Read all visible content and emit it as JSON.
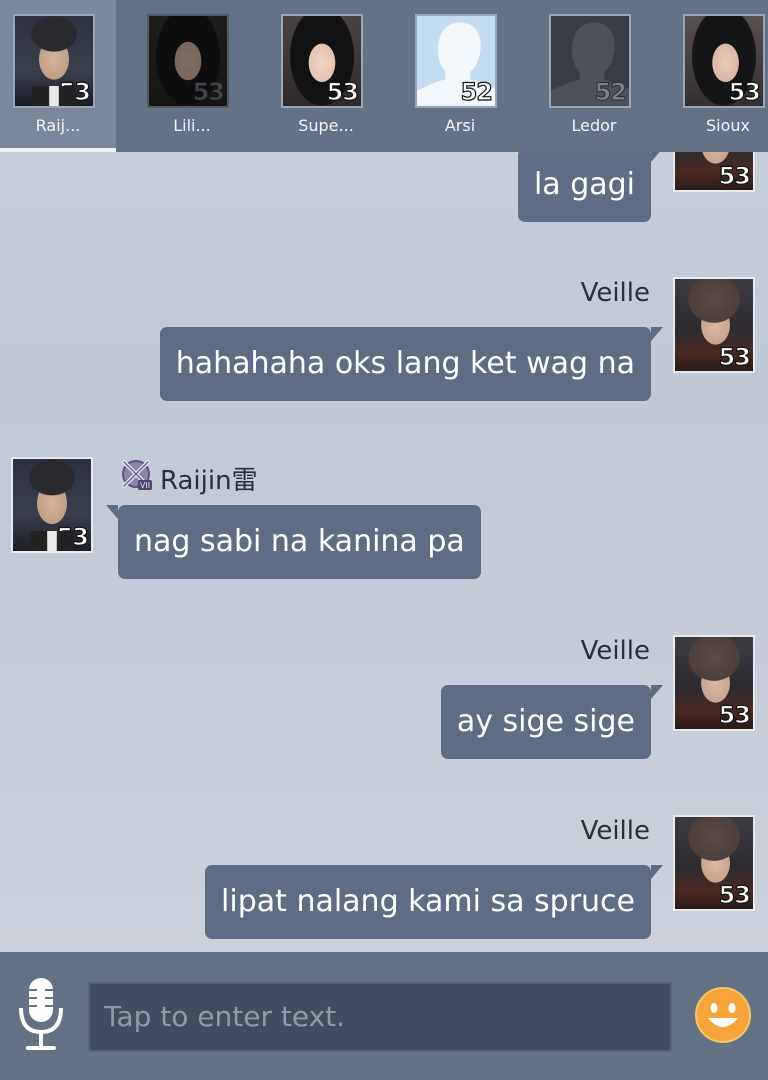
{
  "contacts": [
    {
      "name": "Raij...",
      "level": "53",
      "active": true
    },
    {
      "name": "Lili...",
      "level": "53",
      "active": false
    },
    {
      "name": "Supe...",
      "level": "53",
      "active": false
    },
    {
      "name": "Arsi",
      "level": "52",
      "active": false
    },
    {
      "name": "Ledor",
      "level": "52",
      "active": false
    },
    {
      "name": "Sioux",
      "level": "53",
      "active": false
    }
  ],
  "messages": [
    {
      "text": "la gagi",
      "level": "53"
    },
    {
      "sender": "Veille",
      "text": "hahahaha oks lang ket wag na",
      "level": "53"
    },
    {
      "sender": "Raijin雷",
      "text": "nag sabi na kanina pa",
      "level": "53"
    },
    {
      "sender": "Veille",
      "text": "ay sige sige",
      "level": "53"
    },
    {
      "sender": "Veille",
      "text": "lipat nalang kami sa spruce",
      "level": "53"
    }
  ],
  "input": {
    "placeholder": "Tap to enter text."
  },
  "colors": {
    "bar": "#647286",
    "bubble": "#5f6d84",
    "background": "#c4ccd7",
    "emoji": "#f7a43a"
  },
  "icons": {
    "mic": "microphone-icon",
    "emoji": "smiley-icon",
    "rank": "rank-badge-icon"
  }
}
